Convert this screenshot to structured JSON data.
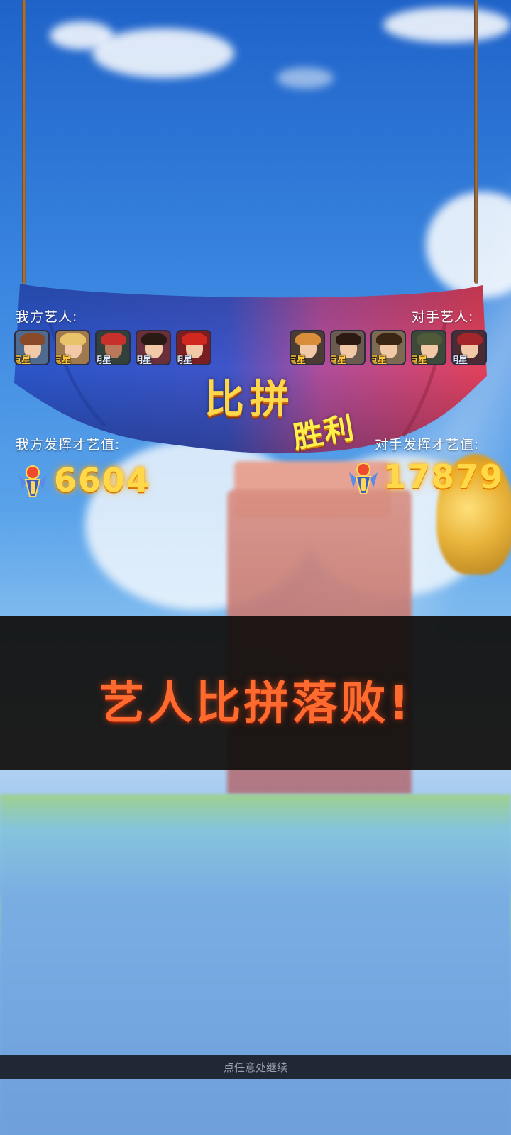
{
  "left_team": {
    "label": "我方艺人:",
    "members": [
      {
        "rank": "巨星",
        "rank_color": "#ffc63c",
        "hair": "#8a4a2a",
        "bg": "#4f6b8f"
      },
      {
        "rank": "巨星",
        "rank_color": "#ffc63c",
        "hair": "#e8c36a",
        "bg": "#9f7a4e"
      },
      {
        "rank": "明星",
        "rank_color": "#dbe8ff",
        "hair": "#c8302c",
        "bg": "#34413a"
      },
      {
        "rank": "明星",
        "rank_color": "#dbe8ff",
        "hair": "#2a1a14",
        "bg": "#6a2f3c"
      },
      {
        "rank": "明星",
        "rank_color": "#dbe8ff",
        "hair": "#d0281e",
        "bg": "#7b1e22"
      }
    ],
    "score_label": "我方发挥才艺值:",
    "score": "6604"
  },
  "right_team": {
    "label": "对手艺人:",
    "members": [
      {
        "rank": "巨星",
        "rank_color": "#ffc63c",
        "hair": "#d88e3a",
        "bg": "#4a3b35"
      },
      {
        "rank": "巨星",
        "rank_color": "#ffc63c",
        "hair": "#2b1a12",
        "bg": "#6b5a4f"
      },
      {
        "rank": "巨星",
        "rank_color": "#ffc63c",
        "hair": "#3a2414",
        "bg": "#7e6a52"
      },
      {
        "rank": "巨星",
        "rank_color": "#ffc63c",
        "hair": "#4f5a3a",
        "bg": "#3d4a3a"
      },
      {
        "rank": "明星",
        "rank_color": "#dbe8ff",
        "hair": "#a3262c",
        "bg": "#4b2b34"
      }
    ],
    "score_label": "对手发挥才艺值:",
    "score": "17879"
  },
  "banner": {
    "title": "比拼",
    "subtitle": "胜利"
  },
  "result_message": "艺人比拼落败!",
  "continue_hint": "点任意处继续"
}
